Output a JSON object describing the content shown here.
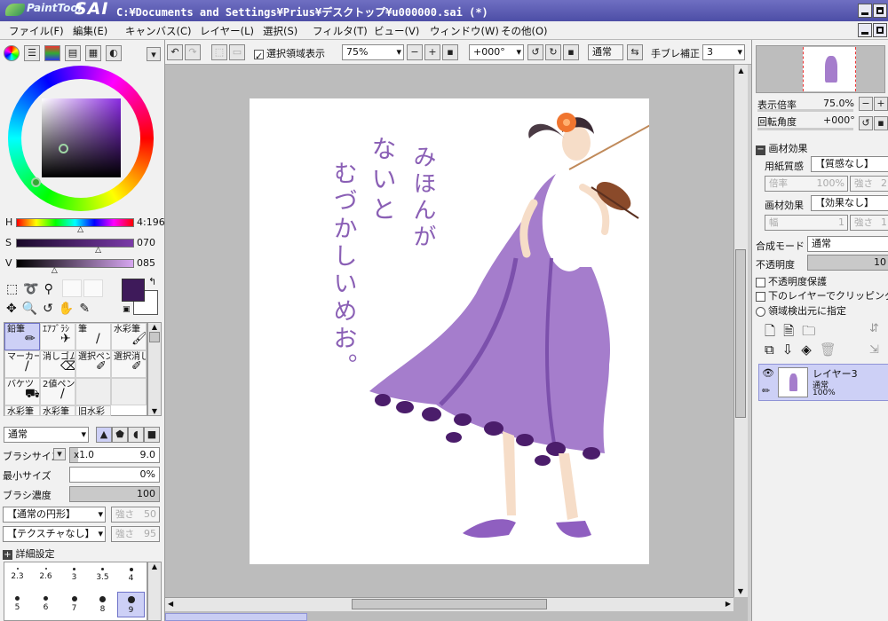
{
  "title": {
    "app_name": "PaintTool",
    "app_short": "SAI",
    "file_path": "C:¥Documents and Settings¥Prius¥デスクトップ¥u000000.sai (*)"
  },
  "menu": [
    "ファイル(F)",
    "編集(E)",
    "キャンバス(C)",
    "レイヤー(L)",
    "選択(S)",
    "フィルタ(T)",
    "ビュー(V)",
    "ウィンドウ(W)",
    "その他(O)"
  ],
  "toolbar": {
    "selection_display_label": "選択領域表示",
    "zoom_value": "75%",
    "rotate_value": "+000°",
    "blend_mode": "通常",
    "stabilizer_label": "手ブレ補正",
    "stabilizer_value": "3"
  },
  "color": {
    "accent": "#3e1a5a",
    "hue_label": "H",
    "hue_value": "4:196",
    "sat_label": "S",
    "sat_value": "070",
    "val_label": "V",
    "val_value": "085",
    "hue_fraction": 0.55,
    "sat_fraction": 0.7,
    "val_fraction": 0.33
  },
  "tools": [
    {
      "label": "鉛筆"
    },
    {
      "label": "ｴｱﾌﾞﾗｼ"
    },
    {
      "label": "筆"
    },
    {
      "label": "水彩筆"
    },
    {
      "label": "マーカー"
    },
    {
      "label": "消しゴム"
    },
    {
      "label": "選択ペン"
    },
    {
      "label": "選択消し"
    },
    {
      "label": "バケツ"
    },
    {
      "label": "2値ペン"
    },
    {
      "label": ""
    },
    {
      "label": ""
    },
    {
      "label": "水彩筆"
    },
    {
      "label": "水彩筆"
    },
    {
      "label": "旧水彩"
    },
    {
      "label": ""
    }
  ],
  "brush": {
    "blend_mode": "通常",
    "size_label": "ブラシサイズ",
    "size_multiplier": "x1.0",
    "size_value": "9.0",
    "min_size_label": "最小サイズ",
    "min_size_value": "0%",
    "density_label": "ブラシ濃度",
    "density_value": "100",
    "shape_select": "【通常の円形】",
    "shape_strength_label": "強さ",
    "shape_strength_value": "50",
    "texture_select": "【テクスチャなし】",
    "texture_strength_label": "強さ",
    "texture_strength_value": "95",
    "details_label": "詳細設定",
    "sizes_row1": [
      "2.3",
      "2.6",
      "3",
      "3.5",
      "4"
    ],
    "sizes_row2": [
      "5",
      "6",
      "7",
      "8",
      "9"
    ]
  },
  "artwork": {
    "handwriting_lines": [
      "みほんが",
      "ないと",
      "むづかしいめお。"
    ]
  },
  "navigator": {
    "zoom_label": "表示倍率",
    "zoom_value": "75.0%",
    "rotate_label": "回転角度",
    "rotate_value": "+000°"
  },
  "material": {
    "section_label": "画材効果",
    "paper_label": "用紙質感",
    "paper_value": "【質感なし】",
    "paper_scale_label": "倍率",
    "paper_scale_value": "100%",
    "paper_strength_label": "強さ",
    "paper_strength_value": "2",
    "effect_label": "画材効果",
    "effect_value": "【効果なし】",
    "effect_width_label": "幅",
    "effect_width_value": "1",
    "effect_strength_label": "強さ",
    "effect_strength_value": "1"
  },
  "layer_props": {
    "blend_label": "合成モード",
    "blend_value": "通常",
    "opacity_label": "不透明度",
    "opacity_value": "10",
    "protect_label": "不透明度保護",
    "clip_label": "下のレイヤーでクリッピング",
    "source_label": "領域検出元に指定"
  },
  "layers": [
    {
      "name": "レイヤー3",
      "mode": "通常",
      "opacity": "100%"
    }
  ]
}
